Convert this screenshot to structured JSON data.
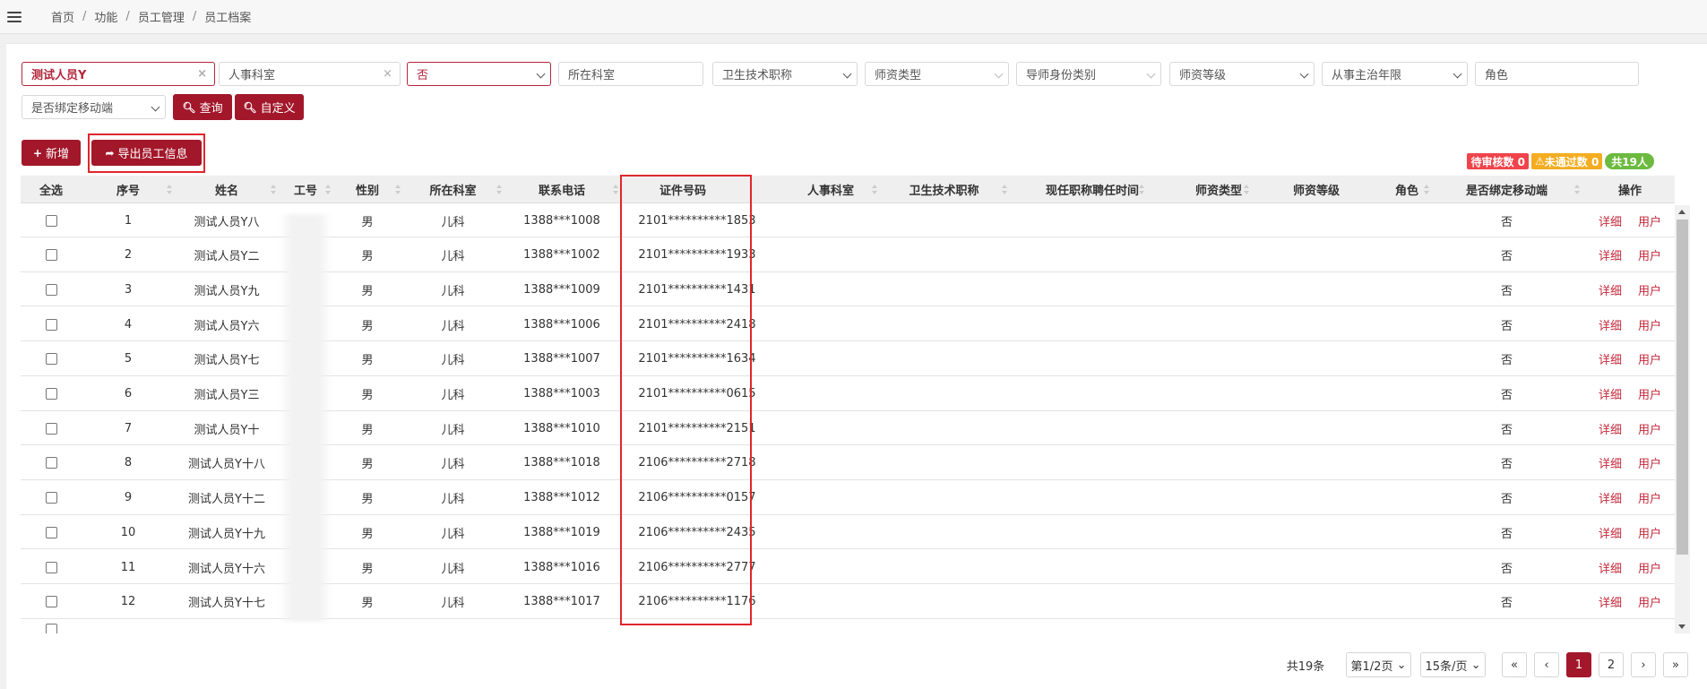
{
  "breadcrumb": [
    "首页",
    "功能",
    "员工管理",
    "员工档案"
  ],
  "filters": {
    "name_value": "测试人员Y",
    "hr_dept_placeholder": "人事科室",
    "yes_no_value": "否",
    "dept_placeholder": "所在科室",
    "title_placeholder": "卫生技术职称",
    "teacher_type_placeholder": "师资类型",
    "mentor_category_placeholder": "导师身份类别",
    "teacher_level_placeholder": "师资等级",
    "years_placeholder": "从事主治年限",
    "role_placeholder": "角色",
    "mobile_bound_placeholder": "是否绑定移动端",
    "clear_glyph": "×"
  },
  "buttons": {
    "query": "查询",
    "custom": "自定义",
    "add": "新增",
    "export": "导出员工信息"
  },
  "badges": {
    "pending": "待审核数 0",
    "failed": "未通过数 0",
    "total": "共19人"
  },
  "columns": {
    "select_all": "全选",
    "index": "序号",
    "name": "姓名",
    "emp_no": "工号",
    "gender": "性别",
    "dept": "所在科室",
    "phone": "联系电话",
    "id_no": "证件号码",
    "hr_dept": "人事科室",
    "title": "卫生技术职称",
    "hire_time": "现任职称聘任时间",
    "teacher_type": "师资类型",
    "teacher_level": "师资等级",
    "role": "角色",
    "mobile_bound": "是否绑定移动端",
    "actions": "操作"
  },
  "rows": [
    {
      "index": "1",
      "name": "测试人员Y八",
      "gender": "男",
      "dept": "儿科",
      "phone": "1388***1008",
      "id_no": "2101**********1853",
      "mobile_bound": "否",
      "detail": "详细",
      "user": "用户"
    },
    {
      "index": "2",
      "name": "测试人员Y二",
      "gender": "男",
      "dept": "儿科",
      "phone": "1388***1002",
      "id_no": "2101**********1933",
      "mobile_bound": "否",
      "detail": "详细",
      "user": "用户"
    },
    {
      "index": "3",
      "name": "测试人员Y九",
      "gender": "男",
      "dept": "儿科",
      "phone": "1388***1009",
      "id_no": "2101**********1431",
      "mobile_bound": "否",
      "detail": "详细",
      "user": "用户"
    },
    {
      "index": "4",
      "name": "测试人员Y六",
      "gender": "男",
      "dept": "儿科",
      "phone": "1388***1006",
      "id_no": "2101**********2418",
      "mobile_bound": "否",
      "detail": "详细",
      "user": "用户"
    },
    {
      "index": "5",
      "name": "测试人员Y七",
      "gender": "男",
      "dept": "儿科",
      "phone": "1388***1007",
      "id_no": "2101**********1634",
      "mobile_bound": "否",
      "detail": "详细",
      "user": "用户"
    },
    {
      "index": "6",
      "name": "测试人员Y三",
      "gender": "男",
      "dept": "儿科",
      "phone": "1388***1003",
      "id_no": "2101**********0615",
      "mobile_bound": "否",
      "detail": "详细",
      "user": "用户"
    },
    {
      "index": "7",
      "name": "测试人员Y十",
      "gender": "男",
      "dept": "儿科",
      "phone": "1388***1010",
      "id_no": "2101**********2151",
      "mobile_bound": "否",
      "detail": "详细",
      "user": "用户"
    },
    {
      "index": "8",
      "name": "测试人员Y十八",
      "gender": "男",
      "dept": "儿科",
      "phone": "1388***1018",
      "id_no": "2106**********2718",
      "mobile_bound": "否",
      "detail": "详细",
      "user": "用户"
    },
    {
      "index": "9",
      "name": "测试人员Y十二",
      "gender": "男",
      "dept": "儿科",
      "phone": "1388***1012",
      "id_no": "2106**********0157",
      "mobile_bound": "否",
      "detail": "详细",
      "user": "用户"
    },
    {
      "index": "10",
      "name": "测试人员Y十九",
      "gender": "男",
      "dept": "儿科",
      "phone": "1388***1019",
      "id_no": "2106**********2435",
      "mobile_bound": "否",
      "detail": "详细",
      "user": "用户"
    },
    {
      "index": "11",
      "name": "测试人员Y十六",
      "gender": "男",
      "dept": "儿科",
      "phone": "1388***1016",
      "id_no": "2106**********2777",
      "mobile_bound": "否",
      "detail": "详细",
      "user": "用户"
    },
    {
      "index": "12",
      "name": "测试人员Y十七",
      "gender": "男",
      "dept": "儿科",
      "phone": "1388***1017",
      "id_no": "2106**********1176",
      "mobile_bound": "否",
      "detail": "详细",
      "user": "用户"
    }
  ],
  "pagination": {
    "total": "共19条",
    "page_select": "第1/2页",
    "page_size": "15条/页",
    "first": "«",
    "prev": "‹",
    "page1": "1",
    "page2": "2",
    "next": "›",
    "last": "»"
  }
}
